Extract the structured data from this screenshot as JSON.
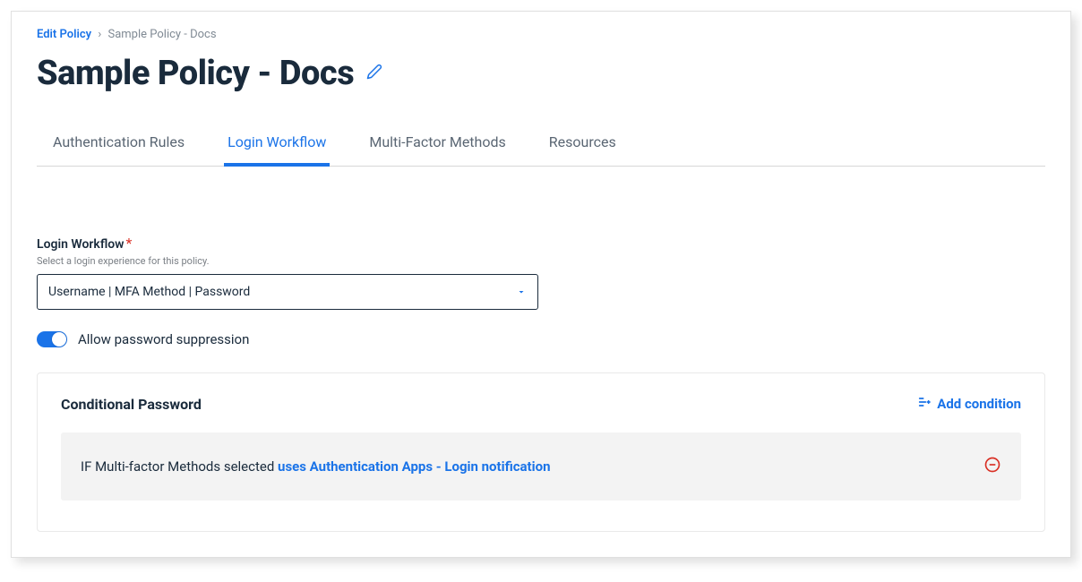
{
  "breadcrumb": {
    "link": "Edit Policy",
    "current": "Sample Policy - Docs"
  },
  "page_title": "Sample Policy - Docs",
  "tabs": [
    {
      "label": "Authentication Rules"
    },
    {
      "label": "Login Workflow"
    },
    {
      "label": "Multi-Factor Methods"
    },
    {
      "label": "Resources"
    }
  ],
  "login_workflow": {
    "label": "Login Workflow",
    "help": "Select a login experience for this policy.",
    "selected": "Username | MFA Method | Password"
  },
  "toggle": {
    "label": "Allow password suppression"
  },
  "conditional_password": {
    "title": "Conditional Password",
    "add_label": "Add condition",
    "condition_prefix": "IF Multi-factor Methods selected ",
    "condition_link": "uses Authentication Apps - Login notification"
  }
}
